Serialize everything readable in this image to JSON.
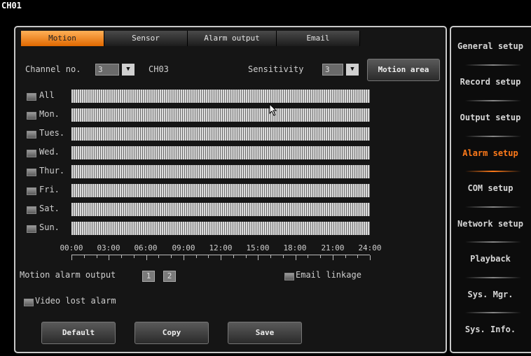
{
  "screen_title": "CH01",
  "tabs": [
    "Motion",
    "Sensor",
    "Alarm output",
    "Email"
  ],
  "channel_label": "Channel no.",
  "channel_value": "3",
  "channel_name": "CH03",
  "sensitivity_label": "Sensitivity",
  "sensitivity_value": "3",
  "motion_area_label": "Motion area",
  "days": [
    "All",
    "Mon.",
    "Tues.",
    "Wed.",
    "Thur.",
    "Fri.",
    "Sat.",
    "Sun."
  ],
  "time_labels": [
    "00:00",
    "03:00",
    "06:00",
    "09:00",
    "12:00",
    "15:00",
    "18:00",
    "21:00",
    "24:00"
  ],
  "motion_alarm_output_label": "Motion alarm output",
  "alarm_outputs": [
    "1",
    "2"
  ],
  "email_linkage_label": "Email linkage",
  "video_lost_alarm_label": "Video lost alarm",
  "buttons": {
    "default": "Default",
    "copy": "Copy",
    "save": "Save"
  },
  "side_menu": [
    "General setup",
    "Record setup",
    "Output setup",
    "Alarm setup",
    "COM setup",
    "Network setup",
    "Playback",
    "Sys. Mgr.",
    "Sys. Info."
  ],
  "active_menu": "Alarm setup",
  "colors": {
    "accent": "#ff7a1a",
    "tab_active": "#f08a20"
  }
}
